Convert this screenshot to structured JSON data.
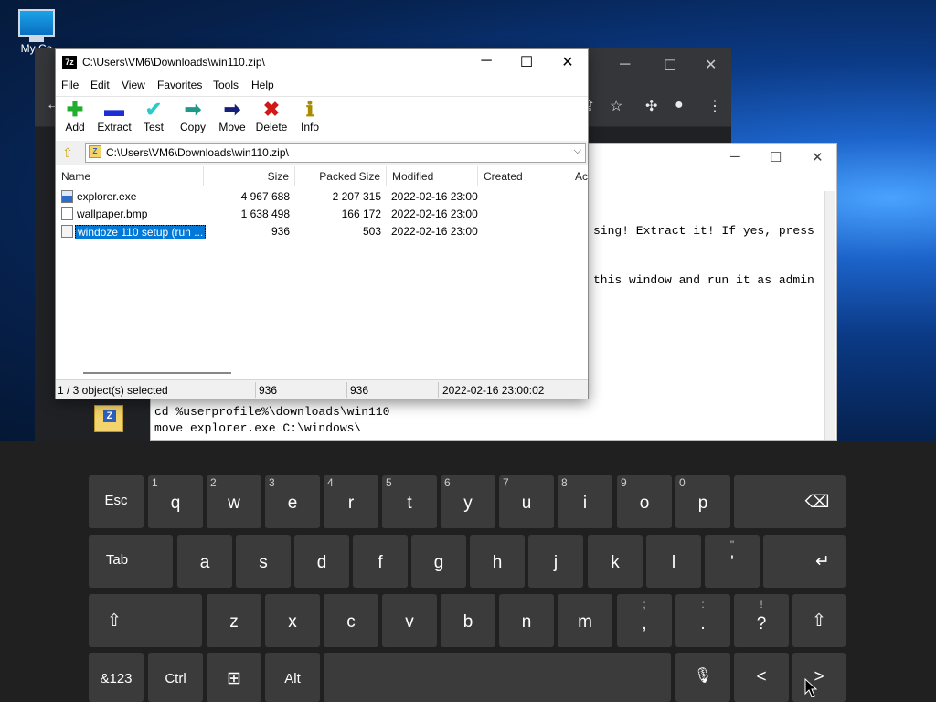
{
  "desktop": {
    "icon_label": "My Co"
  },
  "notepad": {
    "lines": [
      "sing! Extract it! If yes, press",
      "this window and run it as admin",
      "cd %userprofile%\\downloads\\win110",
      "move explorer.exe C:\\windows\\"
    ]
  },
  "zip": {
    "title_icon": "7z",
    "title": "C:\\Users\\VM6\\Downloads\\win110.zip\\",
    "menu": [
      "File",
      "Edit",
      "View",
      "Favorites",
      "Tools",
      "Help"
    ],
    "toolbar": [
      {
        "label": "Add",
        "icon": "plus-icon",
        "glyph": "✚",
        "color": "#1fae2d"
      },
      {
        "label": "Extract",
        "icon": "minus-icon",
        "glyph": "▬",
        "color": "#1c2fd6"
      },
      {
        "label": "Test",
        "icon": "check-icon",
        "glyph": "✔",
        "color": "#2ec9c9"
      },
      {
        "label": "Copy",
        "icon": "arrow-right-icon",
        "glyph": "➡",
        "color": "#1f9a8a"
      },
      {
        "label": "Move",
        "icon": "arrow-right-icon",
        "glyph": "➡",
        "color": "#14207a"
      },
      {
        "label": "Delete",
        "icon": "x-icon",
        "glyph": "✖",
        "color": "#d01a1a"
      },
      {
        "label": "Info",
        "icon": "info-icon",
        "glyph": "ℹ",
        "color": "#a88c00"
      }
    ],
    "address": "C:\\Users\\VM6\\Downloads\\win110.zip\\",
    "columns": [
      "Name",
      "Size",
      "Packed Size",
      "Modified",
      "Created",
      "Ac"
    ],
    "rows": [
      {
        "name": "explorer.exe",
        "size": "4 967 688",
        "packed": "2 207 315",
        "modified": "2022-02-16 23:00",
        "type": "exe",
        "selected": false
      },
      {
        "name": "wallpaper.bmp",
        "size": "1 638 498",
        "packed": "166 172",
        "modified": "2022-02-16 23:00",
        "type": "bmp",
        "selected": false
      },
      {
        "name": "windoze 110 setup (run ...",
        "size": "936",
        "packed": "503",
        "modified": "2022-02-16 23:00",
        "type": "lnk",
        "selected": true
      }
    ],
    "status": {
      "selection": "1 / 3 object(s) selected",
      "size": "936",
      "packed": "936",
      "modified": "2022-02-16 23:00:02"
    }
  },
  "keyboard": {
    "row1": [
      {
        "main": "Esc"
      },
      {
        "main": "q",
        "num": "1"
      },
      {
        "main": "w",
        "num": "2"
      },
      {
        "main": "e",
        "num": "3"
      },
      {
        "main": "r",
        "num": "4"
      },
      {
        "main": "t",
        "num": "5"
      },
      {
        "main": "y",
        "num": "6"
      },
      {
        "main": "u",
        "num": "7"
      },
      {
        "main": "i",
        "num": "8"
      },
      {
        "main": "o",
        "num": "9"
      },
      {
        "main": "p",
        "num": "0"
      },
      {
        "main": ""
      },
      {
        "main": "⌫"
      }
    ],
    "row2": [
      {
        "main": "Tab"
      },
      {
        "main": "a"
      },
      {
        "main": "s"
      },
      {
        "main": "d"
      },
      {
        "main": "f"
      },
      {
        "main": "g"
      },
      {
        "main": "h"
      },
      {
        "main": "j"
      },
      {
        "main": "k"
      },
      {
        "main": "l"
      },
      {
        "main": "'",
        "alt": "\""
      },
      {
        "main": "↵"
      }
    ],
    "row3": [
      {
        "main": "⇧"
      },
      {
        "main": "z"
      },
      {
        "main": "x"
      },
      {
        "main": "c"
      },
      {
        "main": "v"
      },
      {
        "main": "b"
      },
      {
        "main": "n"
      },
      {
        "main": "m"
      },
      {
        "main": ",",
        "alt": ";"
      },
      {
        "main": ".",
        "alt": ":"
      },
      {
        "main": "?",
        "alt": "!"
      },
      {
        "main": "⇧"
      }
    ],
    "row4": [
      {
        "main": "&123"
      },
      {
        "main": "Ctrl"
      },
      {
        "main": "⊞"
      },
      {
        "main": "Alt"
      },
      {
        "main": ""
      },
      {
        "main": "🎙"
      },
      {
        "main": "<"
      },
      {
        "main": ">"
      }
    ]
  }
}
